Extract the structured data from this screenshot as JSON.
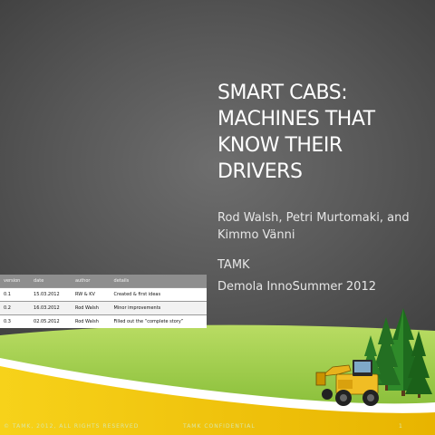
{
  "slide": {
    "title_lines": [
      "SMART CABS:",
      "MACHINES THAT",
      "KNOW THEIR",
      "DRIVERS"
    ],
    "authors_lines": [
      "Rod Walsh, Petri Murtomaki, and",
      "Kimmo Vänni"
    ],
    "organization": "TAMK",
    "event": "Demola InnoSummer 2012"
  },
  "version_table": {
    "headers": [
      "version",
      "date",
      "author",
      "details"
    ],
    "rows": [
      [
        "0.1",
        "15.03.2012",
        "RW & KV",
        "Created & first ideas"
      ],
      [
        "0.2",
        "16.03.2012",
        "Rod Walsh",
        "Minor improvements"
      ],
      [
        "0.3",
        "02.05.2012",
        "Rod Walsh",
        "Filled out the “complete story”"
      ]
    ]
  },
  "footer": {
    "copyright": "© TAMK, 2012, ALL RIGHTS RESERVED",
    "confidential": "TAMK CONFIDENTIAL",
    "page_number": "1"
  },
  "colors": {
    "background_gray": "#575757",
    "grass_green": "#8cc63f",
    "road_yellow": "#f2c200",
    "tree_green": "#1e6b1e",
    "machine_yellow": "#e8b21c"
  },
  "icons": [
    "forest-tree-icon",
    "forestry-machine-icon"
  ]
}
